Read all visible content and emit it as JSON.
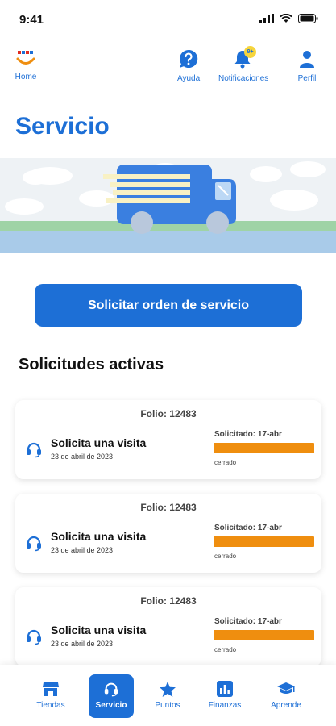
{
  "status_bar": {
    "time": "9:41"
  },
  "header": {
    "home_label": "Home",
    "help_label": "Ayuda",
    "notifications_label": "Notificaciones",
    "notifications_badge": "9+",
    "profile_label": "Perfil"
  },
  "page": {
    "title": "Servicio",
    "primary_button": "Solicitar orden de servicio",
    "section_title": "Solicitudes activas"
  },
  "requests": [
    {
      "folio": "Folio: 12483",
      "title": "Solicita una visita",
      "date": "23 de abril de 2023",
      "requested": "Solicitado: 17-abr",
      "status": "cerrado"
    },
    {
      "folio": "Folio: 12483",
      "title": "Solicita una visita",
      "date": "23 de abril de 2023",
      "requested": "Solicitado: 17-abr",
      "status": "cerrado"
    },
    {
      "folio": "Folio: 12483",
      "title": "Solicita una visita",
      "date": "23 de abril de 2023",
      "requested": "Solicitado: 17-abr",
      "status": "cerrado"
    }
  ],
  "bottom_nav": {
    "items": [
      {
        "label": "Tiendas",
        "icon": "store-icon"
      },
      {
        "label": "Servicio",
        "icon": "headset-icon",
        "active": true
      },
      {
        "label": "Puntos",
        "icon": "star-icon"
      },
      {
        "label": "Finanzas",
        "icon": "chart-icon"
      },
      {
        "label": "Aprende",
        "icon": "graduation-cap-icon"
      }
    ]
  },
  "colors": {
    "accent": "#1d6fd6",
    "status_bar_fill": "#ef8e0f",
    "banner_bg": "#eef2f5"
  }
}
